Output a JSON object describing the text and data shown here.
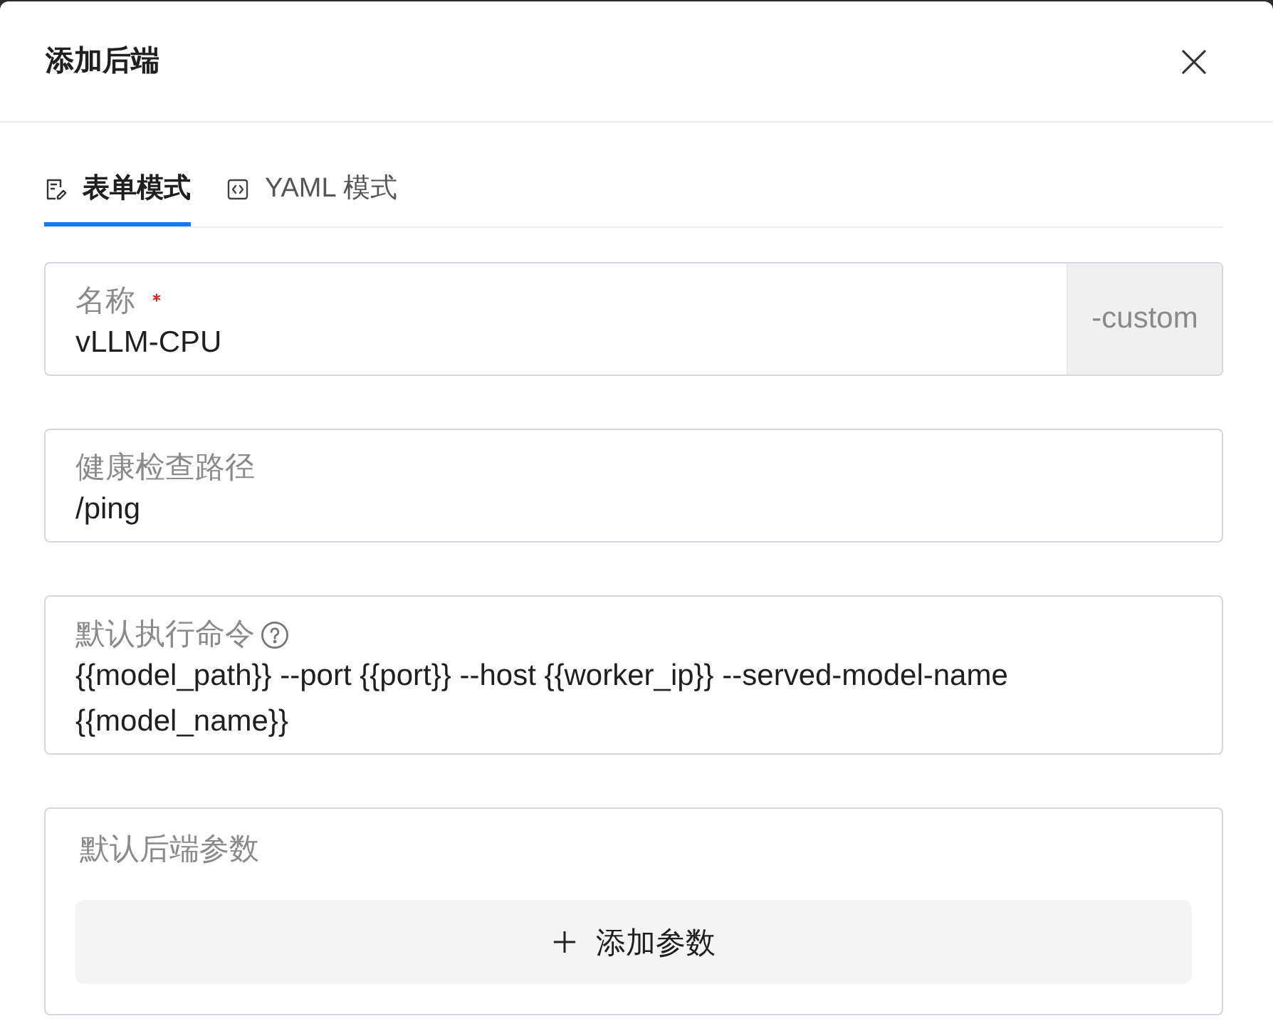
{
  "dialog": {
    "title": "添加后端"
  },
  "tabs": [
    {
      "kind": "form",
      "label": "表单模式",
      "selected": true
    },
    {
      "kind": "yaml",
      "label": "YAML 模式",
      "selected": false
    }
  ],
  "fields": [
    {
      "kind": "input",
      "label": "名称",
      "required": true,
      "help": false,
      "value": "vLLM-CPU",
      "suffix": "-custom"
    },
    {
      "kind": "input",
      "label": "健康检查路径",
      "required": false,
      "help": false,
      "value": "/ping"
    },
    {
      "kind": "textarea",
      "label": "默认执行命令",
      "required": false,
      "help": true,
      "value": "{{model_path}} --port {{port}} --host {{worker_ip}} --served-model-name {{model_name}}"
    },
    {
      "kind": "params",
      "label": "默认后端参数",
      "required": false,
      "help": false,
      "button": "添加参数"
    }
  ]
}
